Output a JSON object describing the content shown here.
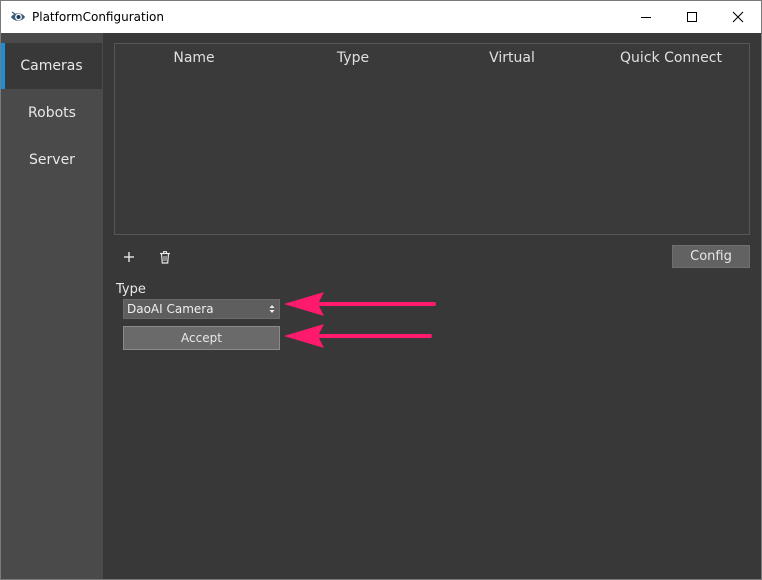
{
  "window": {
    "title": "PlatformConfiguration"
  },
  "sidebar": {
    "items": [
      {
        "label": "Cameras",
        "active": true
      },
      {
        "label": "Robots",
        "active": false
      },
      {
        "label": "Server",
        "active": false
      }
    ]
  },
  "table": {
    "columns": [
      "Name",
      "Type",
      "Virtual",
      "Quick Connect"
    ],
    "rows": []
  },
  "toolbar": {
    "add_icon": "plus-icon",
    "delete_icon": "trash-icon",
    "config_label": "Config"
  },
  "form": {
    "type_label": "Type",
    "type_value": "DaoAI Camera",
    "accept_label": "Accept"
  },
  "colors": {
    "accent": "#1e8fd6",
    "annotation_arrow": "#ff1a6e",
    "background": "#383838",
    "sidebar": "#4a4a4a"
  }
}
